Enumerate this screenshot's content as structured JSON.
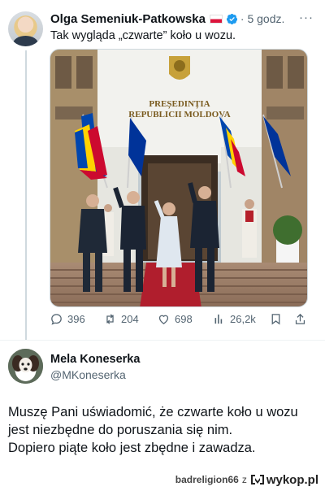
{
  "tweet1": {
    "author_name": "Olga Semeniuk-Patkowska",
    "time": "· 5 godz.",
    "more_label": "···",
    "text": "Tak wygląda „czwarte” koło u wozu.",
    "image_sign_line1": "PREȘEDINȚIA",
    "image_sign_line2": "REPUBLICII MOLDOVA",
    "actions": {
      "replies": "396",
      "reposts": "204",
      "likes": "698",
      "views": "26,2k"
    },
    "icons": [
      "comment-icon",
      "repost-icon",
      "like-icon",
      "views-icon",
      "bookmark-icon",
      "share-icon",
      "verified-icon",
      "flag-icon"
    ]
  },
  "tweet2": {
    "author_name": "Mela Koneserka",
    "handle": "@MKoneserka",
    "lines": [
      "Muszę Pani uświadomić, że czwarte koło u wozu",
      "jest niezbędne do poruszania się nim.",
      "Dopiero piąte koło jest zbędne i zawadza."
    ]
  },
  "watermark": {
    "user": "badreligion66",
    "connector": "z",
    "site": "wykop.pl"
  },
  "colors": {
    "text": "#0f1419",
    "secondary": "#536471",
    "verified": "#1d9bf0",
    "divider": "#eff3f4"
  }
}
